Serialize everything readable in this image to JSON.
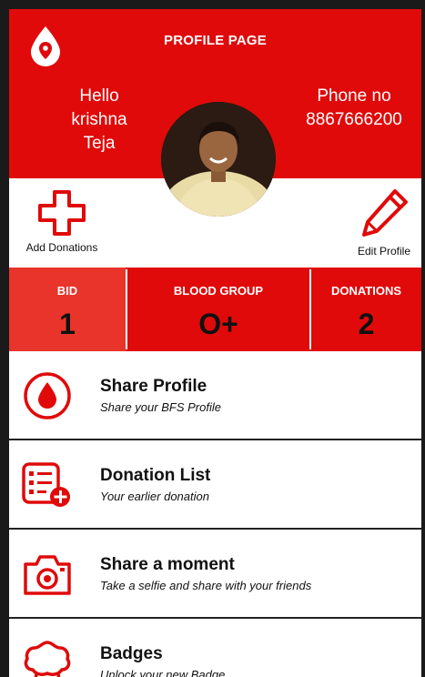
{
  "header": {
    "title": "PROFILE PAGE",
    "greeting_line1": "Hello",
    "greeting_line2": "krishna",
    "greeting_line3": "Teja",
    "phone_label": "Phone no",
    "phone_value": "8867666200"
  },
  "actions": {
    "add_label": "Add Donations",
    "edit_label": "Edit Profile"
  },
  "stats": [
    {
      "label": "BID",
      "value": "1"
    },
    {
      "label": "BLOOD GROUP",
      "value": "O+"
    },
    {
      "label": "DONATIONS",
      "value": "2"
    }
  ],
  "menu": [
    {
      "title": "Share Profile",
      "subtitle": "Share your BFS Profile",
      "icon": "blood-drop-icon"
    },
    {
      "title": "Donation List",
      "subtitle": "Your earlier donation",
      "icon": "list-add-icon"
    },
    {
      "title": "Share a moment",
      "subtitle": "Take a selfie and share with your friends",
      "icon": "camera-icon"
    },
    {
      "title": "Badges",
      "subtitle": "Unlock your new Badge",
      "icon": "badge-icon"
    }
  ],
  "colors": {
    "brand_red": "#e00a0a",
    "stat_highlight": "#e8342a"
  }
}
